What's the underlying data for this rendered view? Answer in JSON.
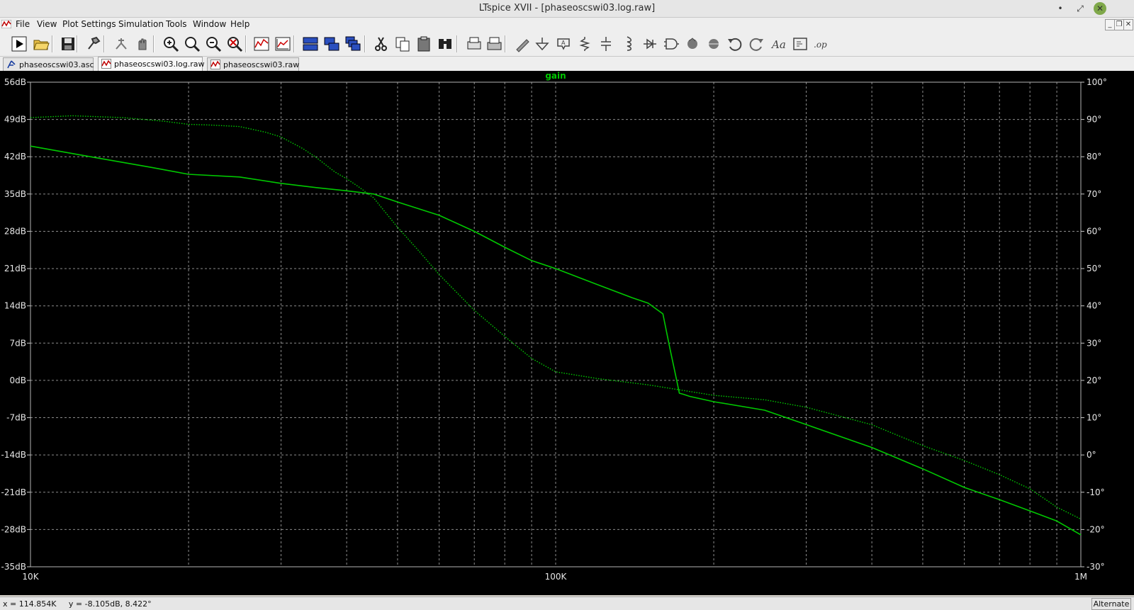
{
  "window": {
    "title": "LTspice XVII - [phaseoscswi03.log.raw]",
    "minimize_glyph": "•",
    "maximize_glyph": "⤢",
    "close_glyph": "✕"
  },
  "menu": {
    "items": [
      "File",
      "View",
      "Plot Settings",
      "Simulation",
      "Tools",
      "Window",
      "Help"
    ]
  },
  "mdi": {
    "minimize_glyph": "_",
    "restore_glyph": "❐",
    "close_glyph": "✕"
  },
  "toolbar": {
    "buttons": [
      "run-icon",
      "open-icon",
      "save-icon",
      "control-panel-icon",
      "halt-icon",
      "pan-hand-icon",
      "zoom-in-icon",
      "zoom-back-icon",
      "zoom-out-icon",
      "zoom-full-icon",
      "autorange-icon",
      "add-trace-icon",
      "tile-horizontal-icon",
      "tile-vertical-icon",
      "cascade-icon",
      "cut-icon",
      "copy-icon",
      "paste-icon",
      "find-icon",
      "print-preview-icon",
      "print-icon",
      "wire-icon",
      "ground-icon",
      "label-net-icon",
      "resistor-icon",
      "capacitor-icon",
      "inductor-icon",
      "diode-icon",
      "component-icon",
      "rotate-icon",
      "mirror-icon",
      "undo-icon",
      "redo-icon",
      "text-icon",
      "spice-directive-icon",
      "spice-op-icon"
    ]
  },
  "tabs": [
    {
      "label": "phaseoscswi03.asc",
      "icon": "schematic-icon",
      "active": false
    },
    {
      "label": "phaseoscswi03.log.raw",
      "icon": "waveform-icon",
      "active": true
    },
    {
      "label": "phaseoscswi03.raw",
      "icon": "waveform-icon",
      "active": false
    }
  ],
  "chart_data": {
    "type": "line",
    "title": "gain",
    "xscale": "log",
    "xlim": [
      10000,
      1000000
    ],
    "x_tick_labels": [
      "10K",
      "100K",
      "1M"
    ],
    "left_axis": {
      "unit": "dB",
      "ylim": [
        -35,
        56
      ],
      "tick_labels": [
        "56dB",
        "49dB",
        "42dB",
        "35dB",
        "28dB",
        "21dB",
        "14dB",
        "7dB",
        "0dB",
        "-7dB",
        "-14dB",
        "-21dB",
        "-28dB",
        "-35dB"
      ]
    },
    "right_axis": {
      "unit": "°",
      "ylim": [
        -30,
        100
      ],
      "tick_labels": [
        "100°",
        "90°",
        "80°",
        "70°",
        "60°",
        "50°",
        "40°",
        "30°",
        "20°",
        "10°",
        "0°",
        "-10°",
        "-20°",
        "-30°"
      ]
    },
    "grid": true,
    "line_color": "#00c800",
    "series": [
      {
        "style": "solid",
        "axis": "left",
        "x": [
          10000,
          13000,
          17000,
          20000,
          25000,
          30000,
          35000,
          40000,
          45000,
          50000,
          60000,
          70000,
          80000,
          90000,
          100000,
          120000,
          140000,
          150000,
          160000,
          165000,
          170000,
          172000,
          175000,
          180000,
          200000,
          250000,
          300000,
          400000,
          500000,
          600000,
          700000,
          800000,
          900000,
          1000000
        ],
        "y": [
          44,
          42,
          40,
          38.7,
          38.2,
          37,
          36.2,
          35.6,
          35,
          33.5,
          31,
          28,
          25,
          22.5,
          21,
          18,
          15.5,
          14.5,
          12.5,
          6,
          0,
          -2.4,
          -2.6,
          -3,
          -4,
          -5.6,
          -8.3,
          -12.6,
          -16.6,
          -20.1,
          -22.4,
          -24.5,
          -26.4,
          -29
        ]
      },
      {
        "style": "dotted",
        "axis": "right",
        "x": [
          10000,
          12000,
          15000,
          18000,
          20000,
          22000,
          25000,
          28000,
          30000,
          33000,
          35000,
          38000,
          40000,
          42000,
          45000,
          50000,
          55000,
          60000,
          70000,
          80000,
          90000,
          100000,
          120000,
          150000,
          200000,
          250000,
          300000,
          400000,
          500000,
          600000,
          700000,
          800000,
          900000,
          1000000
        ],
        "y": [
          90.5,
          91,
          90.5,
          89.5,
          88.7,
          88.5,
          88.1,
          86.6,
          85.3,
          82.2,
          79.8,
          75.9,
          74.1,
          72.1,
          69,
          61.1,
          54.6,
          48.4,
          38.8,
          31.8,
          25.9,
          22.3,
          20.5,
          18.8,
          16,
          14.8,
          12.8,
          8.1,
          2.5,
          -1.5,
          -5.3,
          -9.1,
          -14,
          -17.2
        ]
      }
    ],
    "cursor_readout": {
      "x": "114.854K",
      "y": "-8.105dB, 8.422°"
    }
  },
  "status": {
    "readout": "x = 114.854K     y = -8.105dB, 8.422°",
    "mode": "Alternate"
  }
}
